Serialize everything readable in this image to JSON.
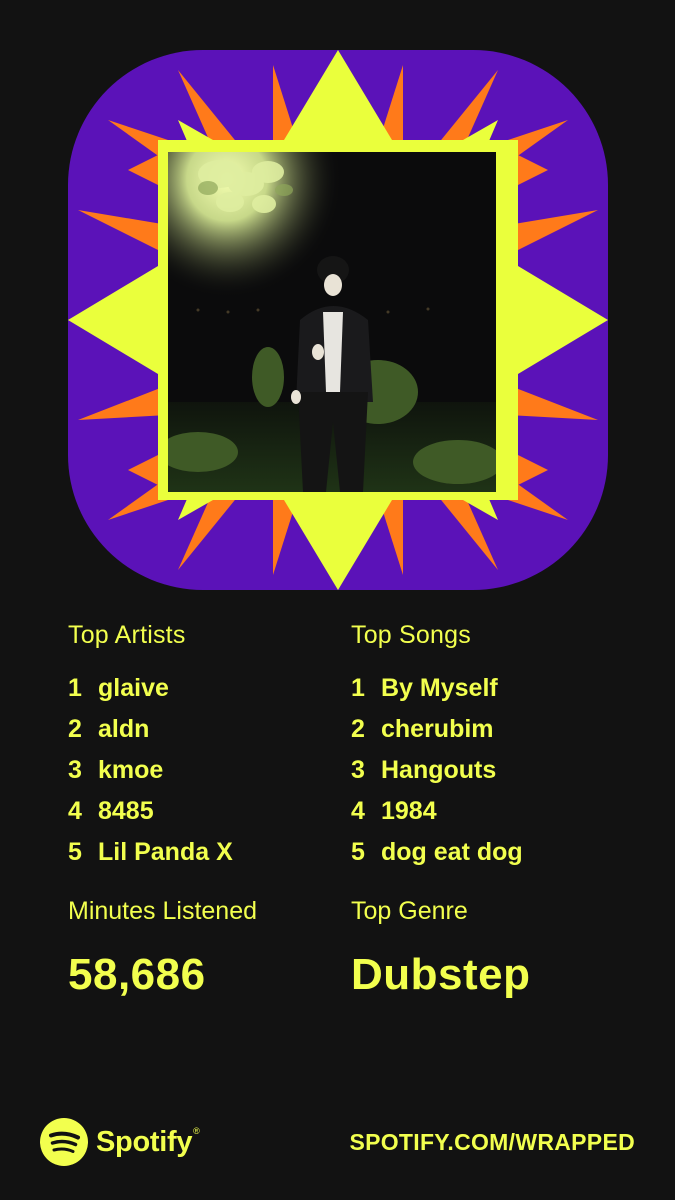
{
  "colors": {
    "background": "#121212",
    "accent_yellow": "#f2ff4e",
    "purple": "#5b12b8",
    "orange": "#ff7a1a",
    "burst_yellow": "#eaff3c"
  },
  "top_artists": {
    "heading": "Top Artists",
    "items": [
      {
        "rank": "1",
        "name": "glaive"
      },
      {
        "rank": "2",
        "name": "aldn"
      },
      {
        "rank": "3",
        "name": "kmoe"
      },
      {
        "rank": "4",
        "name": "8485"
      },
      {
        "rank": "5",
        "name": "Lil Panda X"
      }
    ]
  },
  "top_songs": {
    "heading": "Top Songs",
    "items": [
      {
        "rank": "1",
        "name": "By Myself"
      },
      {
        "rank": "2",
        "name": "cherubim"
      },
      {
        "rank": "3",
        "name": "Hangouts"
      },
      {
        "rank": "4",
        "name": "1984"
      },
      {
        "rank": "5",
        "name": "dog eat dog"
      }
    ]
  },
  "minutes": {
    "heading": "Minutes Listened",
    "value": "58,686"
  },
  "genre": {
    "heading": "Top Genre",
    "value": "Dubstep"
  },
  "footer": {
    "brand": "Spotify",
    "trademark": "®",
    "url": "SPOTIFY.COM/WRAPPED",
    "logo_icon": "spotify-logo-icon"
  },
  "artwork": {
    "icon": "starburst-frame",
    "photo": "top-artist-photo"
  }
}
